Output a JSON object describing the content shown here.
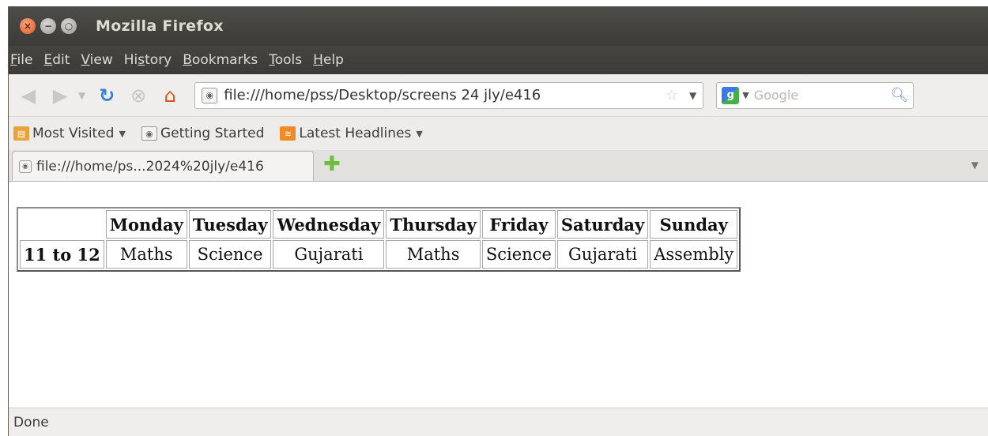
{
  "window": {
    "title": "Mozilla Firefox"
  },
  "menubar": {
    "items": [
      {
        "label": "File",
        "key": "F",
        "rest": "ile"
      },
      {
        "label": "Edit",
        "key": "E",
        "rest": "dit"
      },
      {
        "label": "View",
        "key": "V",
        "rest": "iew"
      },
      {
        "label": "History",
        "pre": "Hi",
        "key": "s",
        "rest": "tory"
      },
      {
        "label": "Bookmarks",
        "key": "B",
        "rest": "ookmarks"
      },
      {
        "label": "Tools",
        "key": "T",
        "rest": "ools"
      },
      {
        "label": "Help",
        "key": "H",
        "rest": "elp"
      }
    ]
  },
  "navbar": {
    "url": "file:///home/pss/Desktop/screens 24 jly/e416",
    "search_placeholder": "Google"
  },
  "bookmarks": {
    "items": [
      {
        "label": "Most Visited",
        "dropdown": true
      },
      {
        "label": "Getting Started"
      },
      {
        "label": "Latest Headlines",
        "dropdown": true
      }
    ]
  },
  "tabs": {
    "active_label": "file:///home/ps...2024%20jly/e416"
  },
  "timetable": {
    "corner": "",
    "days": [
      "Monday",
      "Tuesday",
      "Wednesday",
      "Thursday",
      "Friday",
      "Saturday",
      "Sunday"
    ],
    "row_label": "11 to 12",
    "subjects": [
      "Maths",
      "Science",
      "Gujarati",
      "Maths",
      "Science",
      "Gujarati",
      "Assembly"
    ]
  },
  "status": {
    "text": "Done"
  },
  "colors": {
    "titlebar": "#3c3b37",
    "close_button": "#e15a2a",
    "reload": "#3b7fd4",
    "home": "#d9541f"
  },
  "icons": {
    "back": "back-arrow-icon",
    "forward": "forward-arrow-icon",
    "reload": "reload-icon",
    "stop": "stop-icon",
    "home": "home-icon"
  }
}
